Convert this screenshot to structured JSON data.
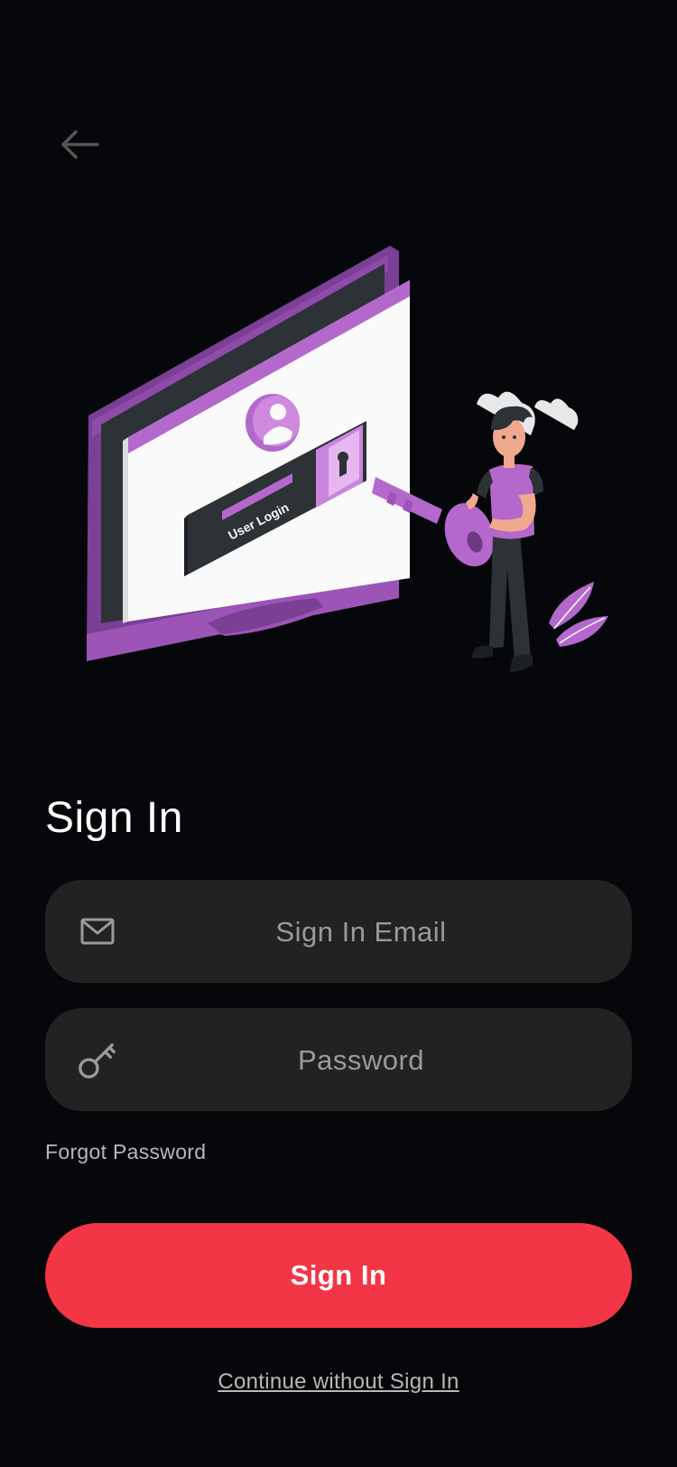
{
  "header": {
    "back_icon": "arrow-left-icon"
  },
  "illustration": {
    "screen_label": "User Login",
    "icons": [
      "user-avatar-icon",
      "keyhole-icon",
      "key-icon",
      "cloud-icon",
      "plant-icon"
    ]
  },
  "title": "Sign In",
  "email_field": {
    "icon": "mail-icon",
    "placeholder": "Sign In Email",
    "value": ""
  },
  "password_field": {
    "icon": "key-icon",
    "placeholder": "Password",
    "value": ""
  },
  "forgot_password": "Forgot Password",
  "sign_in_button": "Sign In",
  "continue_link": "Continue without Sign In",
  "colors": {
    "background": "#06070a",
    "field_background": "#222222",
    "accent": "#f23645",
    "purple": "#b468cc"
  }
}
